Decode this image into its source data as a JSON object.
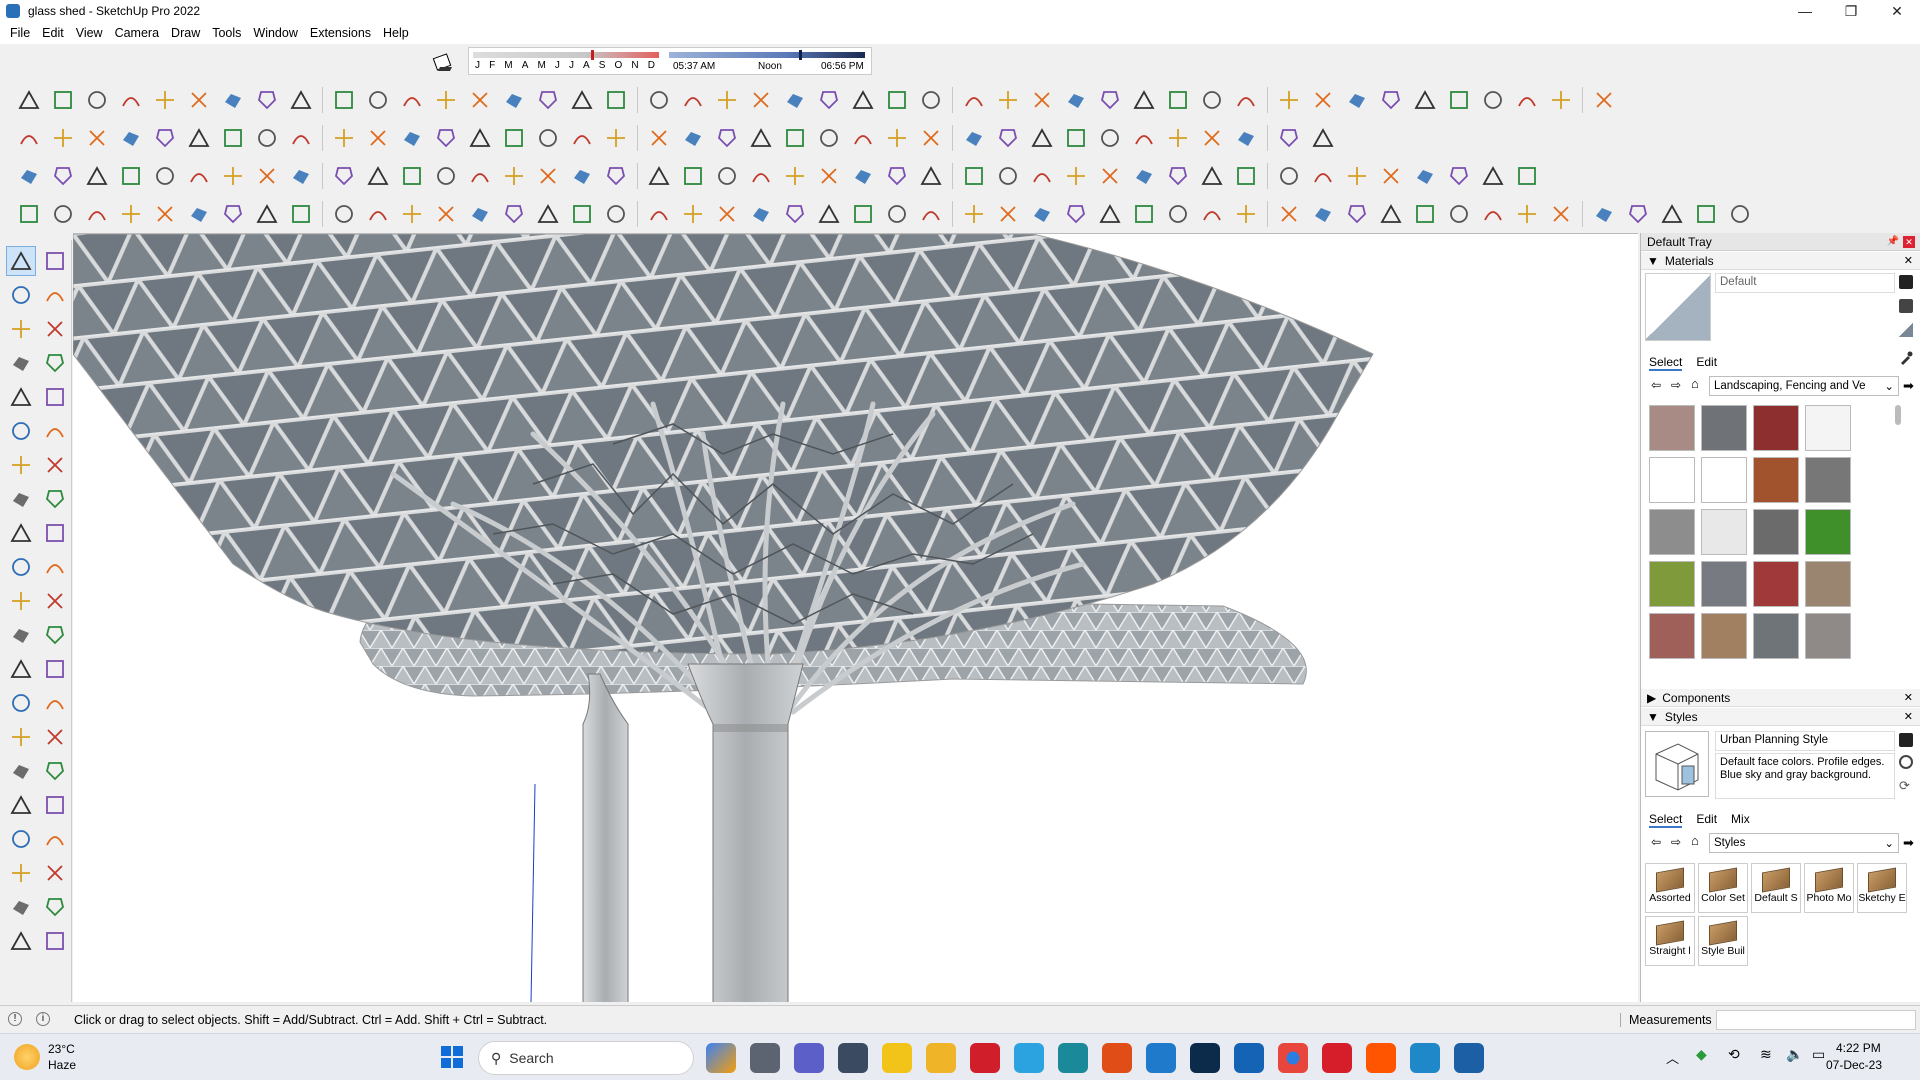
{
  "window": {
    "title": "glass shed - SketchUp Pro 2022",
    "controls": [
      "—",
      "❐",
      "✕"
    ]
  },
  "menu": [
    "File",
    "Edit",
    "View",
    "Camera",
    "Draw",
    "Tools",
    "Window",
    "Extensions",
    "Help"
  ],
  "shadow": {
    "months": [
      "J",
      "F",
      "M",
      "A",
      "M",
      "J",
      "J",
      "A",
      "S",
      "O",
      "N",
      "D"
    ],
    "sunrise": "05:37 AM",
    "noon": "Noon",
    "sunset": "06:56 PM"
  },
  "tray": {
    "title": "Default Tray",
    "materials": {
      "header": "Materials",
      "current": "Default",
      "tabs": [
        "Select",
        "Edit"
      ],
      "library": "Landscaping, Fencing and Ve",
      "swatch_colors": [
        "#a88b84",
        "#6f7378",
        "#8e2f2f",
        "#f4f4f4",
        "#ffffff",
        "#ffffff",
        "#a0532d",
        "#777777",
        "#8d8d8d",
        "#e8e8e8",
        "#6b6b6b",
        "#3f8f2a",
        "#7f9a3a",
        "#777a80",
        "#a03a3a",
        "#9a8570",
        "#a0605a",
        "#a08060",
        "#6e7478",
        "#8f8a88"
      ]
    },
    "components": {
      "header": "Components"
    },
    "styles": {
      "header": "Styles",
      "name": "Urban Planning Style",
      "description": "Default face colors.  Profile edges. Blue sky and gray background.",
      "tabs": [
        "Select",
        "Edit",
        "Mix"
      ],
      "library": "Styles",
      "items": [
        "Assorted",
        "Color Set",
        "Default S",
        "Photo Mo",
        "Sketchy E",
        "Straight l",
        "Style Buil"
      ]
    }
  },
  "status": {
    "hint": "Click or drag to select objects. Shift = Add/Subtract. Ctrl = Add. Shift + Ctrl = Subtract.",
    "measurements_label": "Measurements"
  },
  "taskbar": {
    "weather_temp": "23°C",
    "weather_desc": "Haze",
    "search_placeholder": "Search",
    "time": "4:22 PM",
    "date": "07-Dec-23"
  }
}
